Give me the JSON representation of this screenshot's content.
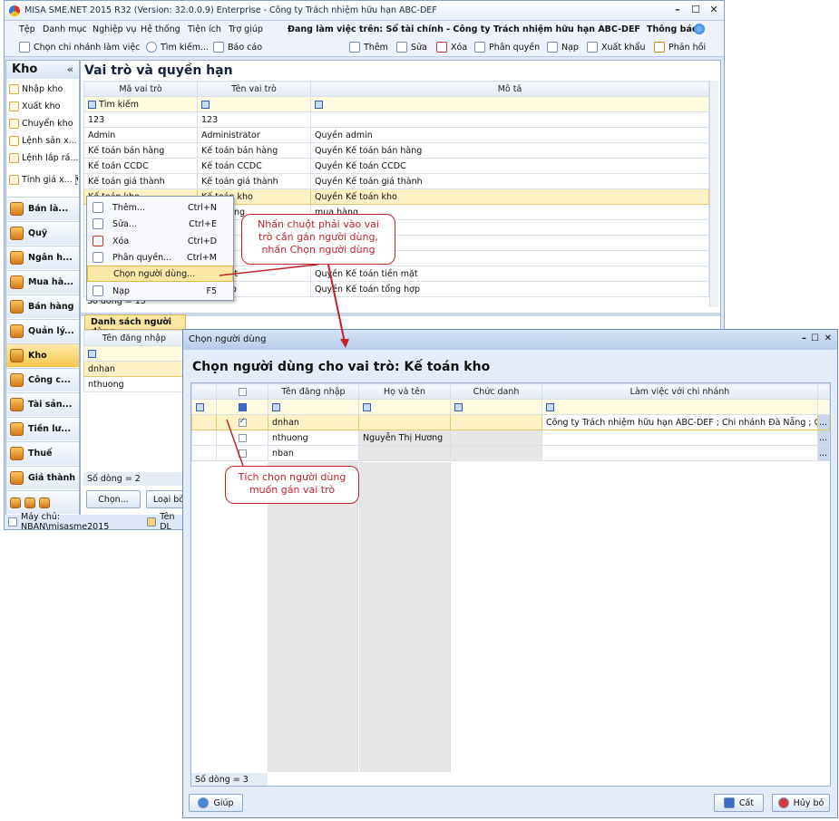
{
  "app": {
    "title": "MISA SME.NET 2015 R32 (Version: 32.0.0.9) Enterprise - Công ty Trách nhiệm hữu hạn ABC-DEF",
    "min": "–",
    "max": "☐",
    "close": "✕"
  },
  "menu": {
    "items": [
      "Tệp",
      "Danh mục",
      "Nghiệp vụ",
      "Hệ thống",
      "Tiện ích",
      "Trợ giúp"
    ],
    "working": "Đang làm việc trên: Sổ tài chính - Công ty Trách nhiệm hữu hạn ABC-DEF",
    "notice": "Thông báo"
  },
  "toolbar": {
    "left": [
      "Chọn chi nhánh làm việc",
      "Tìm kiếm...",
      "Báo cáo"
    ],
    "right": [
      "Thêm",
      "Sửa",
      "Xóa",
      "Phân quyền",
      "Nạp",
      "Xuất khẩu",
      "Phản hồi"
    ]
  },
  "nav": {
    "title": "Kho",
    "collapse": "«",
    "items": [
      "Nhập kho",
      "Xuất kho",
      "Chuyển kho",
      "Lệnh sản x...",
      "Lệnh lắp rá...",
      "Tính giá x..."
    ],
    "modules": [
      "Bán là...",
      "Quỹ",
      "Ngân h...",
      "Mua hà...",
      "Bán hàng",
      "Quản lý...",
      "Kho",
      "Công c...",
      "Tài sản...",
      "Tiền lư...",
      "Thuế",
      "Giá thành"
    ],
    "selected_module": "Kho"
  },
  "main": {
    "title": "Vai trò và quyền hạn",
    "columns": [
      "Mã vai trò",
      "Tên vai trò",
      "Mô tả"
    ],
    "filter_label": "Tìm kiếm",
    "rows": [
      [
        "123",
        "123",
        ""
      ],
      [
        "Admin",
        "Administrator",
        "Quyền admin"
      ],
      [
        "Kế toán bán hàng",
        "Kế toán bán hàng",
        "Quyền Kế toán bán hàng"
      ],
      [
        "Kế toán CCDC",
        "Kế toán CCDC",
        "Quyền Kế toán CCDC"
      ],
      [
        "Kế toán giá thành",
        "Kế toán giá thành",
        "Quyền Kế toán giá thành"
      ],
      [
        "Kế toán kho",
        "Kế toán kho",
        "Quyền Kế toán kho"
      ],
      [
        "",
        "mua hàng",
        "mua hàng"
      ],
      [
        "",
        "",
        "i"
      ],
      [
        "",
        "",
        "i"
      ],
      [
        "",
        "",
        "ương"
      ],
      [
        "",
        "tiền mặt",
        "Quyền Kế toán tiền mặt"
      ],
      [
        "",
        "ổng hợp",
        "Quyền Kế toán tổng hợp"
      ]
    ],
    "row_count": "Số dòng = 15",
    "selected_row": 5
  },
  "users_panel": {
    "tab": "Danh sách người dùng",
    "column": "Tên đăng nhập",
    "users": [
      "dnhan",
      "nthuong"
    ],
    "row_count": "Số dòng = 2",
    "select_btn": "Chọn...",
    "remove_btn": "Loại bỏ"
  },
  "statusbar": {
    "server": "Máy chủ: NBAN\\misasme2015",
    "db": "Tên DL"
  },
  "context_menu": [
    {
      "label": "Thêm...",
      "shortcut": "Ctrl+N"
    },
    {
      "label": "Sửa...",
      "shortcut": "Ctrl+E"
    },
    {
      "label": "Xóa",
      "shortcut": "Ctrl+D"
    },
    {
      "label": "Phân quyền...",
      "shortcut": "Ctrl+M"
    },
    {
      "label": "Chọn người dùng...",
      "shortcut": ""
    },
    {
      "label": "Nạp",
      "shortcut": "F5"
    }
  ],
  "callout1": "Nhấn chuột phải vào vai trò cần gán người dùng, nhấn Chọn người dùng",
  "callout2": "Tích chọn người dùng muốn gán vai trò",
  "dialog": {
    "title": "Chọn người dùng",
    "heading": "Chọn người dùng cho vai trò: Kế toán kho",
    "columns": [
      "Tên đăng nhập",
      "Họ và tên",
      "Chức danh",
      "Làm việc với chi nhánh"
    ],
    "rows": [
      {
        "login": "dnhan",
        "name": "",
        "title": "",
        "branch": "Công ty Trách nhiệm hữu hạn ABC-DEF ; Chi nhánh Đà Nẵng ; Chi n...",
        "checked": true
      },
      {
        "login": "nthuong",
        "name": "Nguyễn Thị Hương",
        "title": "",
        "branch": "",
        "checked": false
      },
      {
        "login": "nban",
        "name": "",
        "title": "",
        "branch": "",
        "checked": false
      }
    ],
    "row_count": "Số dòng = 3",
    "help": "Giúp",
    "save": "Cất",
    "cancel": "Hủy bỏ",
    "ellipsis": "..."
  }
}
